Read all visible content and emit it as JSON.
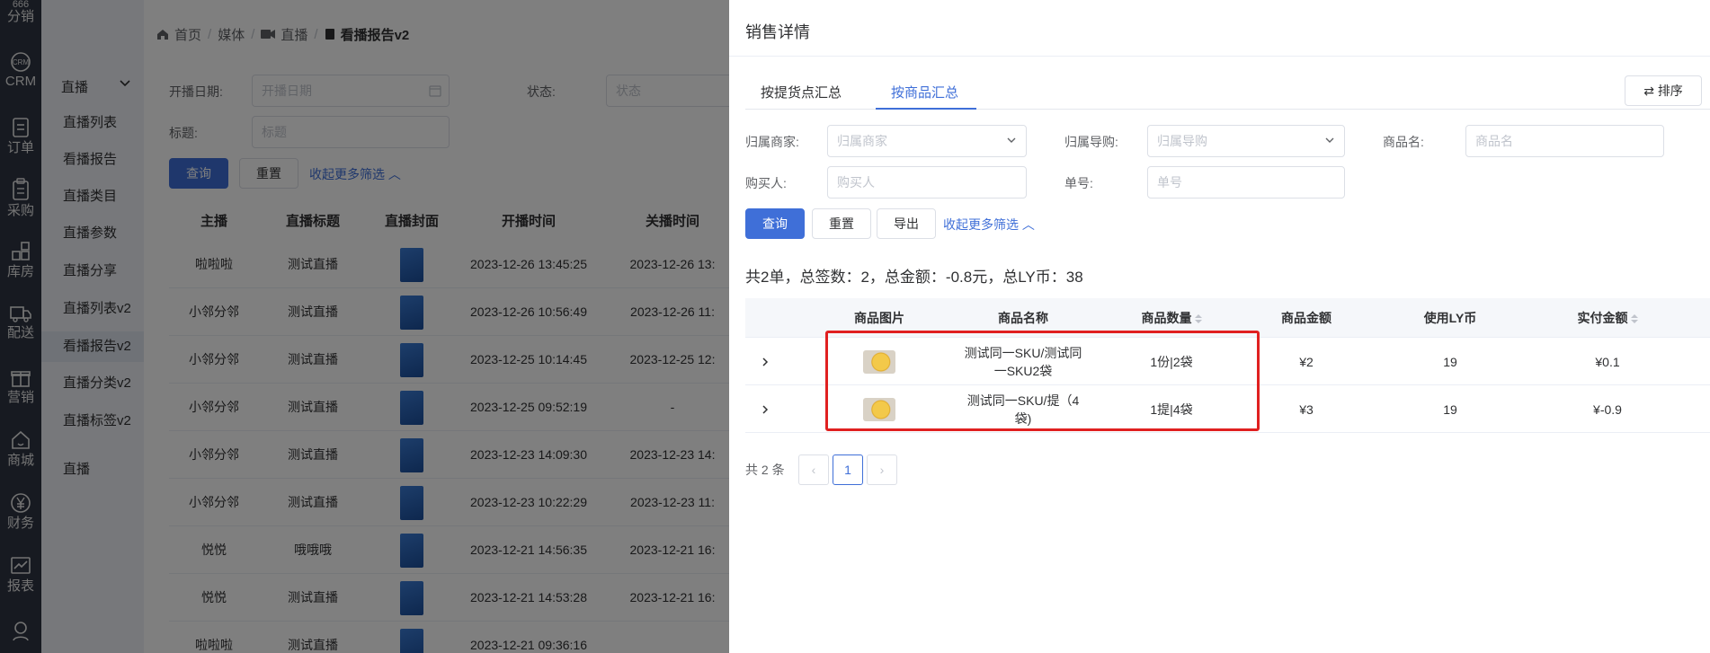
{
  "rail": [
    {
      "icon": "branch-icon",
      "label": "分销"
    },
    {
      "icon": "crm-icon",
      "label": "CRM"
    },
    {
      "icon": "order-icon",
      "label": "订单"
    },
    {
      "icon": "purchase-icon",
      "label": "采购"
    },
    {
      "icon": "warehouse-icon",
      "label": "库房"
    },
    {
      "icon": "truck-icon",
      "label": "配送"
    },
    {
      "icon": "gift-icon",
      "label": "营销"
    },
    {
      "icon": "store-icon",
      "label": "商城"
    },
    {
      "icon": "yen-icon",
      "label": "财务"
    },
    {
      "icon": "report-icon",
      "label": "报表"
    },
    {
      "icon": "user-icon",
      "label": ""
    }
  ],
  "rail_top_label": "666",
  "crm_badge": "CRM",
  "submenu": {
    "group": "直播",
    "items": [
      "直播列表",
      "看播报告",
      "直播类目",
      "直播参数",
      "直播分享",
      "直播列表v2",
      "看播报告v2",
      "直播分类v2",
      "直播标签v2"
    ],
    "footer": "直播",
    "active_index": 6
  },
  "breadcrumb": [
    "首页",
    "媒体",
    "直播",
    "看播报告v2"
  ],
  "filters": {
    "start_label": "开播日期:",
    "start_placeholder": "开播日期",
    "status_label": "状态:",
    "status_placeholder": "状态",
    "title_label": "标题:",
    "title_placeholder": "标题",
    "query": "查询",
    "reset": "重置",
    "collapse": "收起更多筛选"
  },
  "bg_table": {
    "headers": [
      "主播",
      "直播标题",
      "直播封面",
      "开播时间",
      "关播时间"
    ],
    "rows": [
      [
        "啦啦啦",
        "测试直播",
        "2023-12-26 13:45:25",
        "2023-12-26 13:"
      ],
      [
        "小邻分邻",
        "测试直播",
        "2023-12-26 10:56:49",
        "2023-12-26 11:"
      ],
      [
        "小邻分邻",
        "测试直播",
        "2023-12-25 10:14:45",
        "2023-12-25 12:"
      ],
      [
        "小邻分邻",
        "测试直播",
        "2023-12-25 09:52:19",
        "-"
      ],
      [
        "小邻分邻",
        "测试直播",
        "2023-12-23 14:09:30",
        "2023-12-23 14:"
      ],
      [
        "小邻分邻",
        "测试直播",
        "2023-12-23 10:22:29",
        "2023-12-23 11:"
      ],
      [
        "悦悦",
        "哦哦哦",
        "2023-12-21 14:56:35",
        "2023-12-21 16:"
      ],
      [
        "悦悦",
        "测试直播",
        "2023-12-21 14:53:28",
        "2023-12-21 16:"
      ],
      [
        "啦啦啦",
        "测试直播",
        "2023-12-21 09:36:16",
        ""
      ]
    ]
  },
  "drawer": {
    "title": "销售详情",
    "tabs": [
      "按提货点汇总",
      "按商品汇总"
    ],
    "active_tab": 1,
    "sort_button": "排序",
    "filters": {
      "merchant_label": "归属商家:",
      "merchant_placeholder": "归属商家",
      "guide_label": "归属导购:",
      "guide_placeholder": "归属导购",
      "product_label": "商品名:",
      "product_placeholder": "商品名",
      "buyer_label": "购买人:",
      "buyer_placeholder": "购买人",
      "order_label": "单号:",
      "order_placeholder": "单号"
    },
    "buttons": {
      "query": "查询",
      "reset": "重置",
      "export": "导出",
      "collapse": "收起更多筛选"
    },
    "summary": "共2单，总签数：2，总金额：-0.8元，总LY币：38",
    "table": {
      "headers": [
        "商品图片",
        "商品名称",
        "商品数量",
        "商品金额",
        "使用LY币",
        "实付金额"
      ],
      "rows": [
        {
          "name_line1": "测试同一SKU/测试同",
          "name_line2": "一SKU2袋",
          "qty": "1份|2袋",
          "amount": "¥2",
          "ly": "19",
          "paid": "¥0.1"
        },
        {
          "name_line1": "测试同一SKU/提（4",
          "name_line2": "袋)",
          "qty": "1提|4袋",
          "amount": "¥3",
          "ly": "19",
          "paid": "¥-0.9"
        }
      ]
    },
    "pagination": {
      "total": "共 2 条",
      "current": "1",
      "prev": "‹",
      "next": "›"
    }
  }
}
